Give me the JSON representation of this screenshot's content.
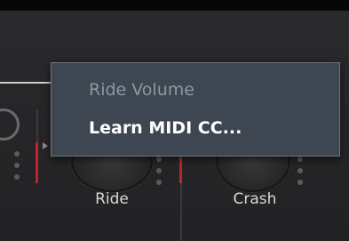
{
  "context_menu": {
    "header": "Ride Volume",
    "items": [
      {
        "label": "Learn MIDI CC..."
      }
    ]
  },
  "knobs": [
    {
      "label": "Ride"
    },
    {
      "label": "Crash"
    }
  ],
  "colors": {
    "panel": "#262628",
    "menu_bg": "#3e4751",
    "menu_border": "#6b7680",
    "menu_disabled_text": "#8d97a1",
    "menu_text": "#ffffff",
    "level_red": "#c0232b",
    "label_text": "#d8d8d8"
  }
}
